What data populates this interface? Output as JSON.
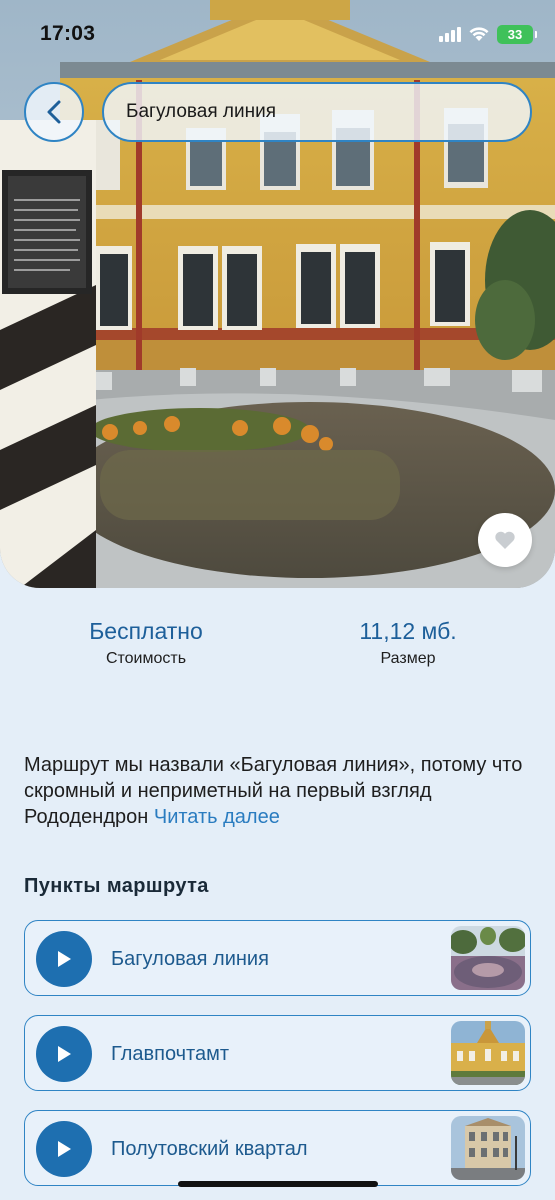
{
  "status_bar": {
    "time": "17:03",
    "battery": "33"
  },
  "header": {
    "back_icon": "chevron-left-icon",
    "title": "Багуловая линия"
  },
  "hero": {
    "like_icon": "heart-icon"
  },
  "stats": {
    "cost_value": "Бесплатно",
    "cost_label": "Стоимость",
    "size_value": "11,12 мб.",
    "size_label": "Размер"
  },
  "description": {
    "text": "Маршрут мы назвали «Багуловая линия», потому что скромный и неприметный на первый взгляд Рододендрон",
    "read_more": "Читать далее"
  },
  "points": {
    "heading": "Пункты маршрута",
    "items": [
      {
        "name": "Багуловая линия"
      },
      {
        "name": "Главпочтамт"
      },
      {
        "name": "Полутовский квартал"
      }
    ]
  },
  "colors": {
    "accent": "#2f84c4",
    "play_button": "#1e6fb0",
    "link": "#2a7cc0",
    "background": "#e4eef8"
  }
}
